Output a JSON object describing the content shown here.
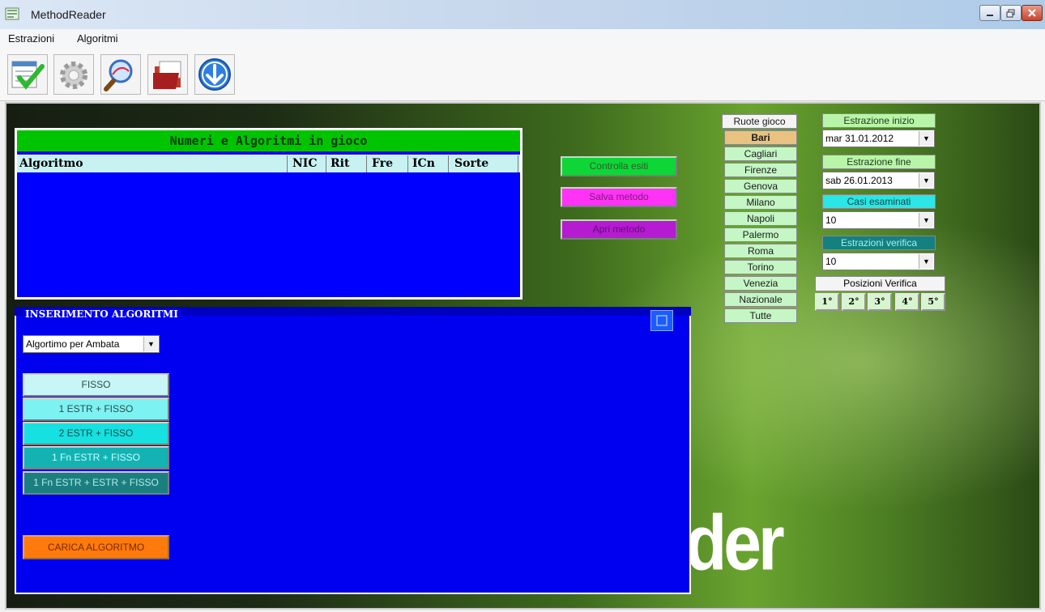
{
  "window": {
    "title": "MethodReader"
  },
  "menu": {
    "items": [
      "Estrazioni",
      "Algoritmi"
    ]
  },
  "toolbar": {
    "icons": [
      "checklist-icon",
      "gear-icon",
      "magnifier-icon",
      "folder-icon",
      "download-arrow-icon"
    ]
  },
  "numbers_panel": {
    "title": "Numeri e Algoritmi in gioco",
    "columns": [
      "Algoritmo",
      "NIC",
      "Rit",
      "Fre",
      "ICn",
      "Sorte"
    ]
  },
  "actions": {
    "controlla": "Controlla esiti",
    "salva": "Salva metodo",
    "apri": "Apri metodo"
  },
  "ruote": {
    "title": "Ruote gioco",
    "items": [
      "Bari",
      "Cagliari",
      "Firenze",
      "Genova",
      "Milano",
      "Napoli",
      "Palermo",
      "Roma",
      "Torino",
      "Venezia",
      "Nazionale",
      "Tutte"
    ],
    "selected": "Bari"
  },
  "estrazione_inizio": {
    "label": "Estrazione inizio",
    "value": "mar 31.01.2012"
  },
  "estrazione_fine": {
    "label": "Estrazione fine",
    "value": "sab 26.01.2013"
  },
  "casi_esaminati": {
    "label": "Casi esaminati",
    "value": "10"
  },
  "estrazioni_verifica": {
    "label": "Estrazioni verifica",
    "value": "10"
  },
  "posizioni_verifica": {
    "label": "Posizioni Verifica",
    "items": [
      "1°",
      "2°",
      "3°",
      "4°",
      "5°"
    ]
  },
  "inserimento": {
    "legend": "INSERIMENTO ALGORITMI",
    "combo_value": "Algortimo per Ambata",
    "buttons": [
      "FISSO",
      "1 ESTR + FISSO",
      "2 ESTR + FISSO",
      "1 Fn ESTR + FISSO",
      "1 Fn ESTR + ESTR + FISSO"
    ],
    "load_button": "CARICA ALGORITMO"
  },
  "background_logo": "der",
  "colors": {
    "title_bar": "#c6d7ec",
    "panel_blue": "#0000ff",
    "title_green": "#00c400",
    "controlla": "#0ed637",
    "salva": "#ff33f5",
    "apri": "#b51bd1",
    "carica": "#ff7a0c"
  }
}
